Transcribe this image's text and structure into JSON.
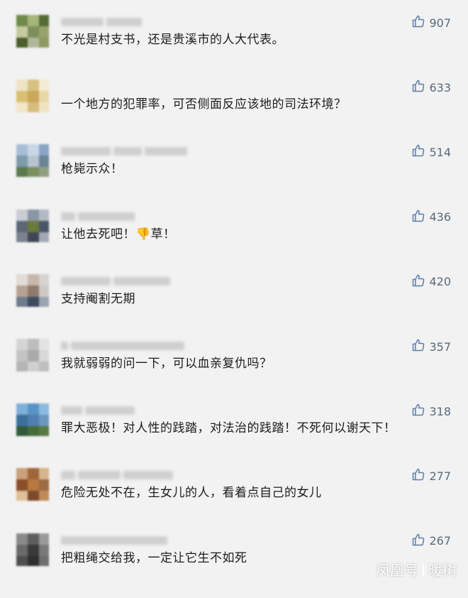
{
  "comments": [
    {
      "text": "不光是村支书，还是贵溪市的人大代表。",
      "likes": "907",
      "avatar_colors": [
        "#6f8a4a",
        "#a7b57a",
        "#556b35",
        "#c7c9a0",
        "#7d8f5c",
        "#98a36a",
        "#4a5d2a",
        "#b1b89a",
        "#8c9a62"
      ],
      "name_blocks": [
        60,
        50
      ]
    },
    {
      "text": "一个地方的犯罪率，可否侧面反应该地的司法环境？",
      "likes": "633",
      "avatar_colors": [
        "#efe4c6",
        "#d7c27f",
        "#f3ead2",
        "#d9bf73",
        "#c9a85a",
        "#e8d8a8",
        "#f1e6c8",
        "#d6bd7c",
        "#efe2bd"
      ],
      "name_blocks": []
    },
    {
      "text": "枪毙示众！",
      "likes": "514",
      "avatar_colors": [
        "#a8bdd6",
        "#c9d6e6",
        "#8aa4c4",
        "#7f9aa8",
        "#b7c4cf",
        "#6a8496",
        "#5d7a4e",
        "#7b9060",
        "#8f9f80"
      ],
      "name_blocks": [
        70,
        40,
        60
      ]
    },
    {
      "text": "让他去死吧！",
      "emoji": "👎",
      "text2": "草！",
      "likes": "436",
      "avatar_colors": [
        "#c9cdd4",
        "#8a96a6",
        "#b3bac6",
        "#5c6674",
        "#6b7a3a",
        "#4a5566",
        "#7a828f",
        "#3f4756",
        "#a2a9b5"
      ],
      "name_blocks": [
        20,
        80
      ]
    },
    {
      "text": "支持阉割无期",
      "likes": "420",
      "avatar_colors": [
        "#e2dcd6",
        "#c7b7aa",
        "#d8d3cf",
        "#b8a294",
        "#8e7a6e",
        "#cfc9c3",
        "#6f7a8c",
        "#3c4a5e",
        "#9aa3b0"
      ],
      "name_blocks": [
        70,
        80
      ]
    },
    {
      "text": "我就弱弱的问一下，可以血亲复仇吗？",
      "likes": "357",
      "avatar_colors": [
        "#d5d5d5",
        "#bdbdbd",
        "#e3e3e3",
        "#c4c4c4",
        "#a9a9a9",
        "#d9d9d9",
        "#b5b5b5",
        "#cfcfcf",
        "#bfbfbf"
      ],
      "name_blocks": [
        10,
        160
      ]
    },
    {
      "text": "罪大恶极！对人性的践踏，对法治的践踏！不死何以谢天下！",
      "likes": "318",
      "avatar_colors": [
        "#7fb0d8",
        "#5a93c6",
        "#8cbbe0",
        "#3d6f9a",
        "#4f7fae",
        "#6b96bd",
        "#2f5a3c",
        "#456b3a",
        "#587a44"
      ],
      "name_blocks": [
        30,
        70
      ]
    },
    {
      "text": "危险无处不在，生女儿的人，看着点自己的女儿",
      "likes": "277",
      "avatar_colors": [
        "#c9a07a",
        "#a0653a",
        "#d8b48c",
        "#8a4e2a",
        "#b8783e",
        "#9c6a44",
        "#e0c09a",
        "#7a4a2a",
        "#c28a5a"
      ],
      "name_blocks": [
        20,
        60,
        70
      ]
    },
    {
      "text": "把粗绳交给我，一定让它生不如死",
      "likes": "267",
      "avatar_colors": [
        "#8a8a8a",
        "#5e5e5e",
        "#9a9a9a",
        "#6a6a6a",
        "#3a3a3a",
        "#7a7a7a",
        "#4e4e4e",
        "#2e2e2e",
        "#6e6e6e"
      ],
      "name_blocks": [
        150
      ]
    }
  ],
  "watermark": {
    "brand": "凤凰号",
    "author": "暖树"
  }
}
